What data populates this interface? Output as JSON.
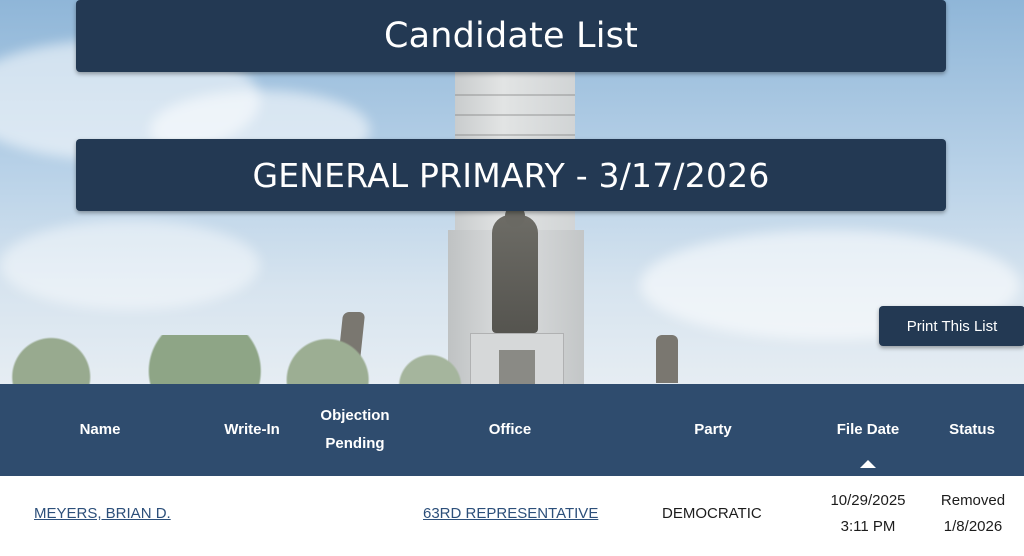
{
  "header": {
    "title": "Candidate List",
    "election": "GENERAL PRIMARY - 3/17/2026",
    "print_button": "Print This List"
  },
  "table": {
    "columns": {
      "name": "Name",
      "write_in": "Write-In",
      "objection_line1": "Objection",
      "objection_line2": "Pending",
      "office": "Office",
      "party": "Party",
      "file_date": "File Date",
      "status": "Status"
    },
    "sorted_column": "file_date",
    "sort_direction": "ascending",
    "rows": [
      {
        "name": "MEYERS, BRIAN D.",
        "write_in": "",
        "objection_pending": "",
        "office": "63RD REPRESENTATIVE",
        "party": "DEMOCRATIC",
        "file_date_line1": "10/29/2025",
        "file_date_line2": "3:11 PM",
        "status_line1": "Removed",
        "status_line2": "1/8/2026"
      }
    ]
  },
  "colors": {
    "banner": "#233953",
    "table_header": "#2f4c6e",
    "link": "#2c4f7a"
  }
}
